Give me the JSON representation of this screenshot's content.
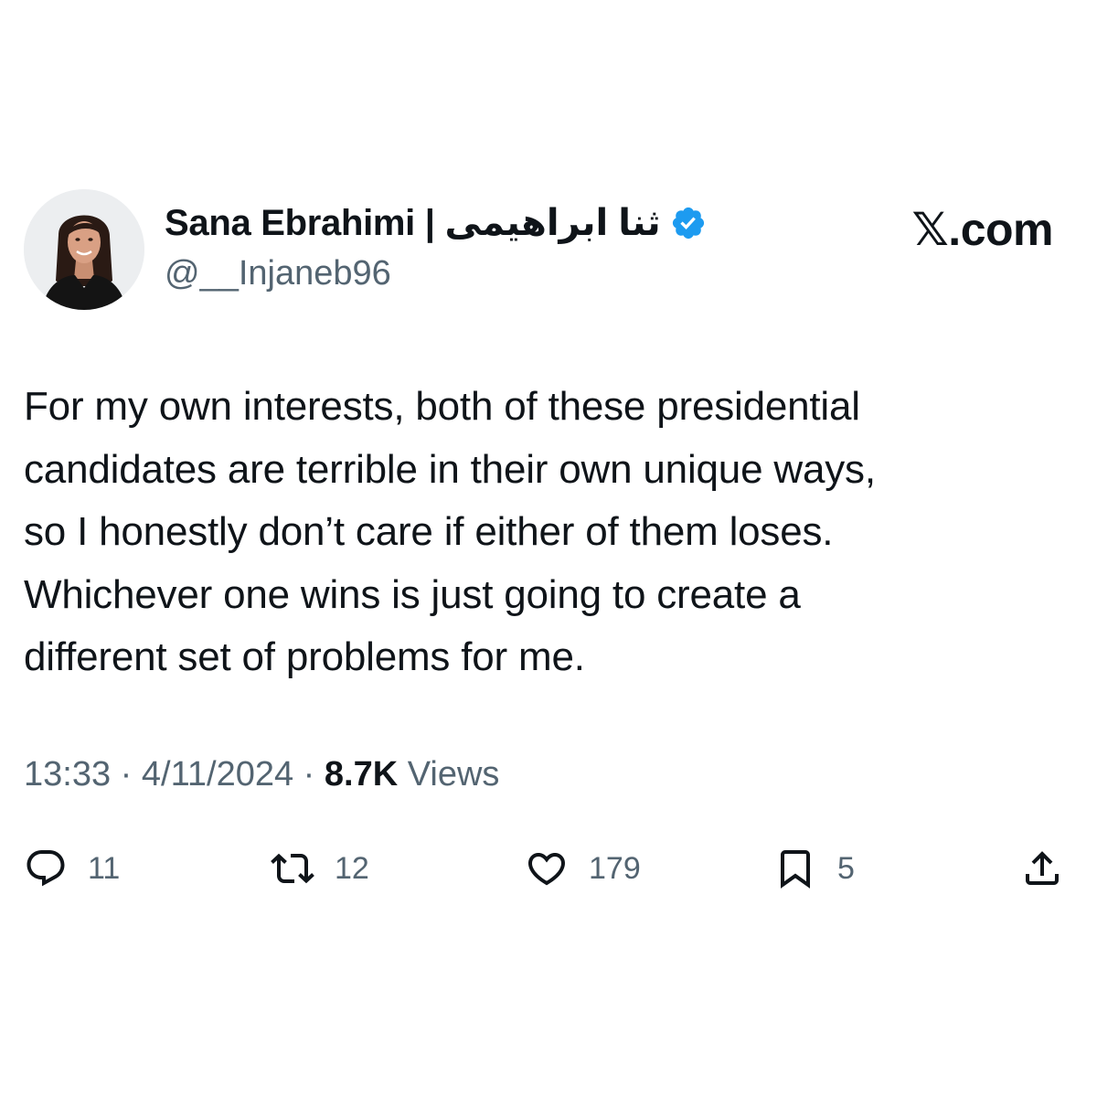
{
  "author": {
    "display_name": "Sana Ebrahimi | ثنا ابراهیمی",
    "handle": "@__Injaneb96",
    "verified_icon": "verified-badge-icon",
    "verified_color": "#1d9bf0"
  },
  "brand": {
    "label": "𝕏.com"
  },
  "tweet": {
    "lines": [
      "For my own interests, both of these presidential",
      "candidates are terrible in their own unique ways,",
      "so I honestly don’t care if either of them loses.",
      "Whichever one wins is just going to create a",
      "different set of problems for me."
    ]
  },
  "meta": {
    "time": "13:33",
    "separator": "·",
    "date": "4/11/2024",
    "views_count": "8.7K",
    "views_label": "Views"
  },
  "actions": {
    "reply": {
      "icon": "reply-bubble-icon",
      "count": "11"
    },
    "retweet": {
      "icon": "retweet-icon",
      "count": "12"
    },
    "like": {
      "icon": "heart-icon",
      "count": "179"
    },
    "bookmark": {
      "icon": "bookmark-icon",
      "count": "5"
    },
    "share": {
      "icon": "share-icon"
    }
  },
  "colors": {
    "text_primary": "#0f1419",
    "text_secondary": "#536471",
    "accent": "#1d9bf0"
  }
}
